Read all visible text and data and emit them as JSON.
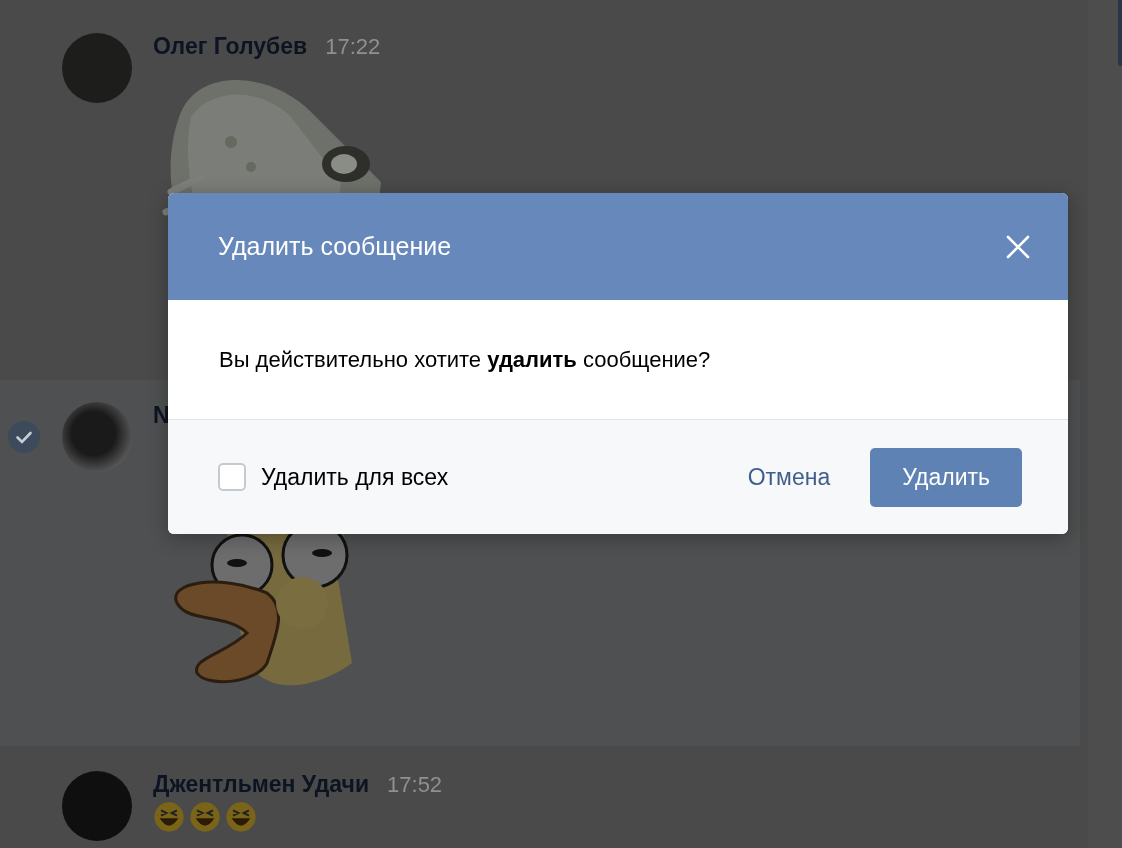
{
  "messages": [
    {
      "author": "Олег Голубев",
      "time": "17:22",
      "selected": false,
      "content": {
        "kind": "sticker"
      }
    },
    {
      "author": "N",
      "selected": true,
      "content": {
        "kind": "sticker"
      }
    },
    {
      "author": "Джентльмен Удачи",
      "time": "17:52",
      "selected": false,
      "content": {
        "kind": "emoji",
        "items": [
          {
            "kind": "laughing"
          },
          {
            "kind": "laughing"
          },
          {
            "kind": "laughing"
          }
        ]
      }
    }
  ],
  "dialog": {
    "title": "Удалить сообщение",
    "message": "Вы действительно хотите **удалить** сообщение?",
    "checkbox": {
      "label": "Удалить для всех",
      "checked": false
    },
    "buttons": [
      {
        "label": "Отмена",
        "kind": "link"
      },
      {
        "label": "Удалить",
        "kind": "primary"
      }
    ]
  }
}
